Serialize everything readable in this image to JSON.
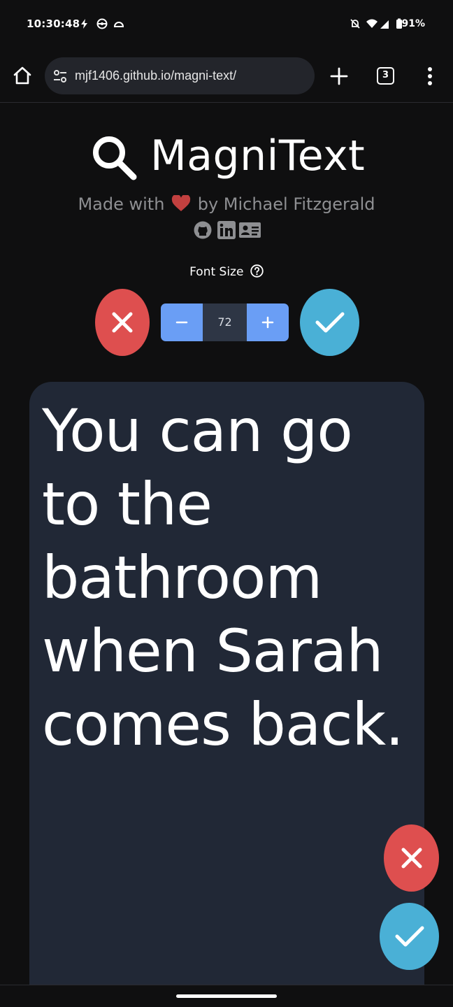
{
  "status_bar": {
    "time": "10:30:48",
    "battery": "91%",
    "icons": [
      "bolt-icon",
      "pokeball-icon",
      "cloud-icon",
      "mute-icon",
      "wifi-icon",
      "signal-icon",
      "battery-icon"
    ]
  },
  "browser": {
    "url": "mjf1406.github.io/magni-text/",
    "tab_count": "3",
    "icons": [
      "home-icon",
      "site-settings-icon",
      "new-tab-icon",
      "tab-switcher-icon",
      "menu-icon"
    ]
  },
  "app": {
    "title": "MagniText",
    "made_with_prefix": "Made with",
    "made_with_suffix": "by Michael Fitzgerald",
    "social_icons": [
      "github-icon",
      "linkedin-icon",
      "contact-card-icon"
    ],
    "font_size_label": "Font Size",
    "font_size_value": "72",
    "minus_label": "−",
    "plus_label": "+",
    "display_text": "You can go to the bathroom when Sarah comes back.",
    "colors": {
      "cancel": "#de4f4f",
      "confirm": "#4ab0d6",
      "stepper": "#6a9ef5",
      "text_area": "#212836",
      "heart": "#c2403f"
    }
  }
}
